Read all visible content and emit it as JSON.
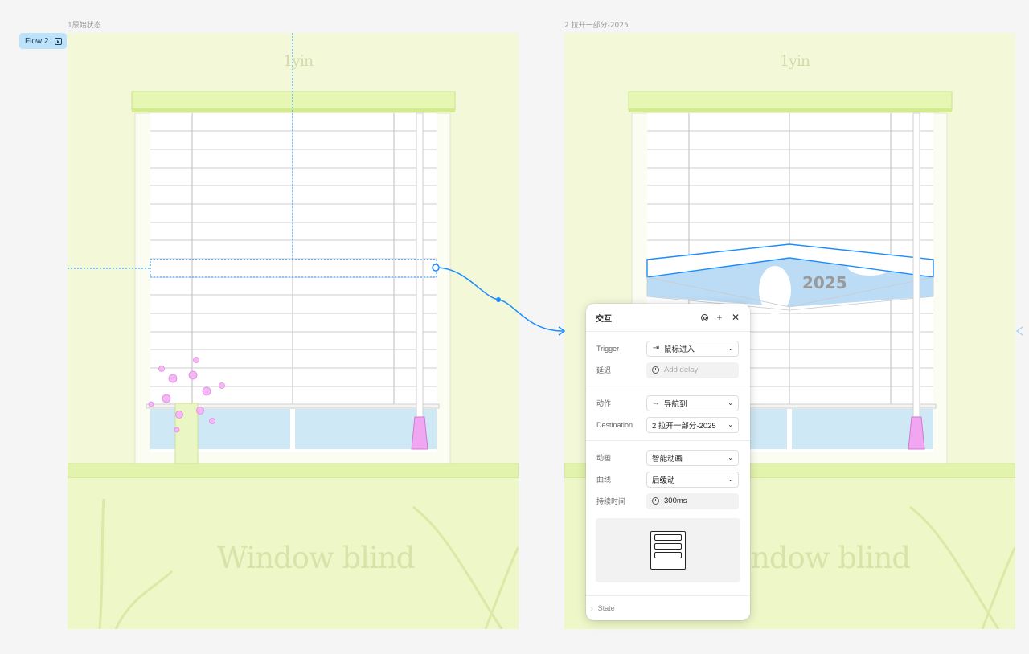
{
  "frames": [
    {
      "label": "1原始状态",
      "logo": "1yin",
      "caption": "Window blind"
    },
    {
      "label": "2 拉开一部分-2025",
      "logo": "1yin",
      "caption": "ndow blind",
      "sky_text": "2025"
    }
  ],
  "flow": {
    "label": "Flow 2",
    "icon": "play-frame-icon"
  },
  "colors": {
    "bg": "#f5f5f5",
    "frame": "#f3f8d8",
    "valance": "#e6f7b4",
    "ground": "#e9f5bb",
    "selection": "#1a8cff",
    "window_glass": "#cfe8f5",
    "sky": "#bcdcf6"
  },
  "panel": {
    "title": "交互",
    "icons": [
      "target-icon",
      "plus-icon",
      "close-icon"
    ],
    "trigger": {
      "label": "Trigger",
      "value": "鼠标进入",
      "icon": "enter-icon"
    },
    "delay": {
      "label": "延迟",
      "placeholder": "Add delay"
    },
    "action": {
      "label": "动作",
      "value": "导航到",
      "icon": "arrow-right-icon"
    },
    "destination": {
      "label": "Destination",
      "value": "2 拉开一部分-2025"
    },
    "animation": {
      "label": "动画",
      "value": "智能动画"
    },
    "curve": {
      "label": "曲线",
      "value": "后缓动"
    },
    "duration": {
      "label": "持续时间",
      "value": "300ms"
    },
    "state": {
      "label": "State"
    }
  }
}
